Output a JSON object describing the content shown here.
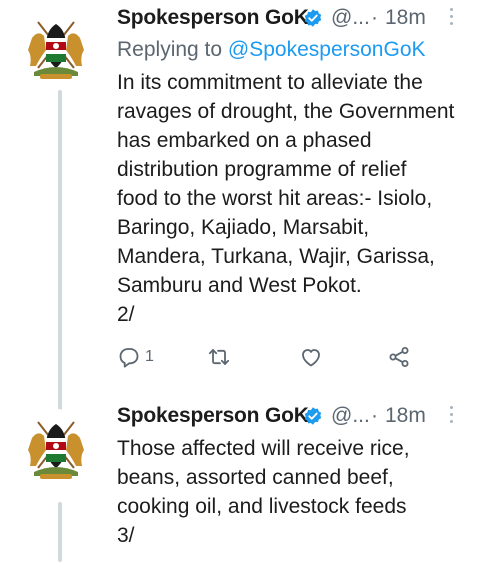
{
  "tweets": [
    {
      "name": "Spokesperson GoK",
      "handle": "@...",
      "dot": "·",
      "time": "18m",
      "reply_prefix": "Replying to ",
      "reply_to": "@SpokespersonGoK",
      "text": "In its commitment to alleviate the\nravages of drought, the Government\nhas embarked on a phased\ndistribution programme of relief\nfood to the worst hit areas:- Isiolo,\nBaringo, Kajiado, Marsabit,\nMandera, Turkana, Wajir, Garissa,\nSamburu and West Pokot.\n2/",
      "reply_count": "1",
      "icons": [
        "reply-icon",
        "retweet-icon",
        "like-icon",
        "share-icon"
      ]
    },
    {
      "name": "Spokesperson GoK",
      "handle": "@...",
      "dot": "·",
      "time": "18m",
      "text": "Those affected will receive rice,\nbeans, assorted canned beef,\ncooking oil, and livestock feeds\n3/"
    }
  ],
  "colors": {
    "text": "#1c1c1c",
    "secondary": "#5b6670",
    "link": "#1d9bf0",
    "thread_line": "#cfd9de"
  }
}
